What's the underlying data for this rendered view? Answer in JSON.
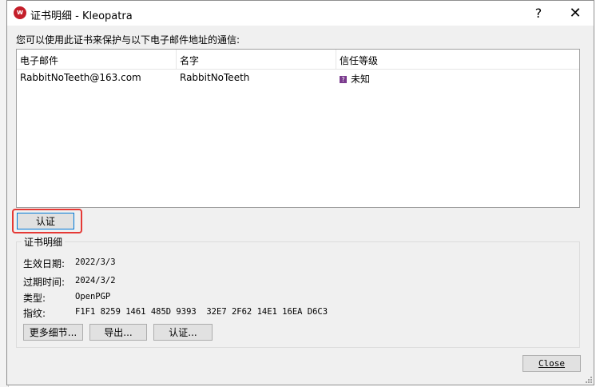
{
  "window": {
    "title": "证书明细 - Kleopatra",
    "app_icon_glyph": "w",
    "help_glyph": "?",
    "close_glyph": "✕"
  },
  "prompt": "您可以使用此证书来保护与以下电子邮件地址的通信:",
  "table": {
    "columns": [
      "电子邮件",
      "名字",
      "信任等级"
    ],
    "rows": [
      {
        "email": "RabbitNoTeeth@163.com",
        "name": "RabbitNoTeeth",
        "trust_icon": "question-icon",
        "trust_glyph": "?",
        "trust": "未知"
      }
    ]
  },
  "certify_top_label": "认证",
  "details": {
    "group_title": "证书明细",
    "rows": [
      {
        "label": "生效日期:",
        "value": "2022/3/3"
      },
      {
        "label": "过期时间:",
        "value": "2024/3/2"
      },
      {
        "label": "类型:",
        "value": "OpenPGP"
      },
      {
        "label": "指纹:",
        "value": "F1F1 8259 1461 485D 9393  32E7 2F62 14E1 16EA D6C3"
      }
    ],
    "buttons": {
      "more": "更多细节...",
      "export": "导出...",
      "certify": "认证..."
    }
  },
  "close_label": "Close",
  "colors": {
    "highlight": "#e53935",
    "focus": "#0078d7",
    "trust_icon": "#7b3b8e"
  }
}
